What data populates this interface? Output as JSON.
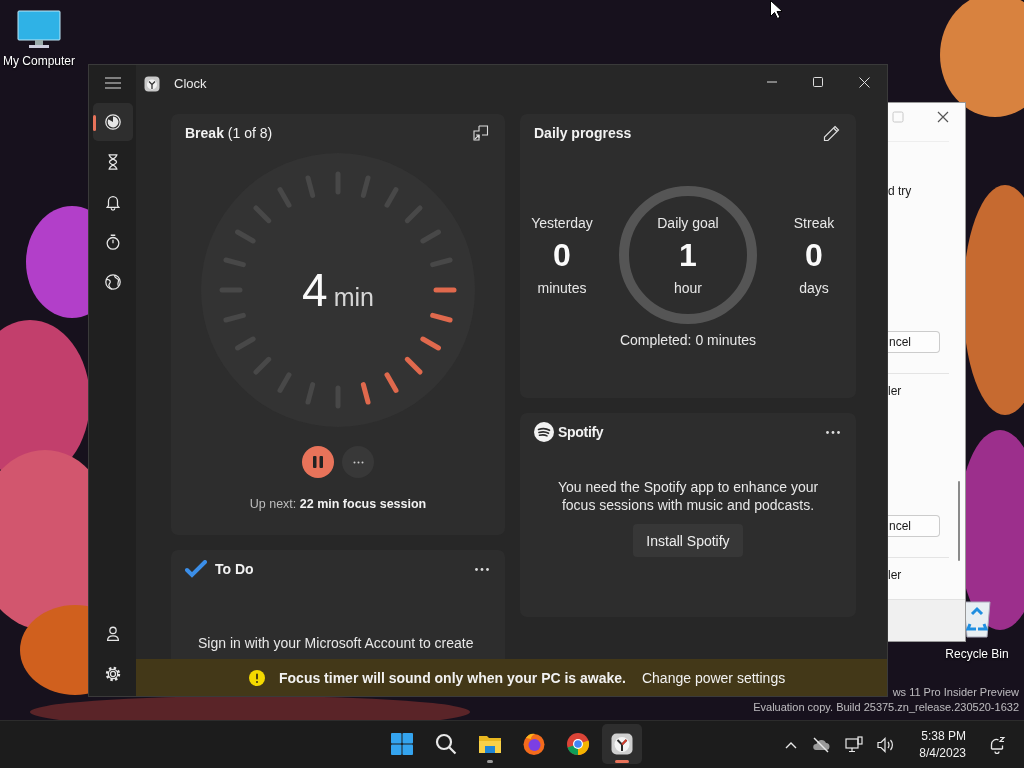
{
  "desktop_icons": [
    {
      "kind": "computer",
      "label": "My Computer"
    },
    {
      "kind": "recycle",
      "label": "Recycle Bin"
    }
  ],
  "watermark": [
    "ws 11 Pro Insider Preview",
    "Evaluation copy. Build 25375.zn_release.230520-1632"
  ],
  "background_window": {
    "sections": [
      {
        "text": "d try",
        "button": "ncel"
      },
      {
        "text": "ler",
        "button": "ncel"
      },
      {
        "text": "ler"
      }
    ]
  },
  "window": {
    "title": "Clock"
  },
  "sidebar": {
    "top": [
      {
        "kind": "focus",
        "selected": true
      },
      {
        "kind": "timer",
        "selected": false
      },
      {
        "kind": "alarm",
        "selected": false
      },
      {
        "kind": "stopwatch",
        "selected": false
      },
      {
        "kind": "world",
        "selected": false
      }
    ],
    "bottom": [
      {
        "kind": "account",
        "selected": false
      },
      {
        "kind": "settings",
        "selected": false
      }
    ]
  },
  "timer": {
    "title": "**Break** (1 of 8)",
    "value": "4",
    "unit": "min",
    "running": true,
    "up_next": "Up next: **22 min focus session**"
  },
  "todo": {
    "title": "To Do",
    "message": "Sign in with your Microsoft Account to create"
  },
  "daily": {
    "title": "Daily progress",
    "stats": [
      {
        "kind": "stat",
        "label": "Yesterday",
        "value": "0",
        "unit": "minutes"
      },
      {
        "kind": "goal",
        "label": "Daily goal",
        "value": "1",
        "unit": "hour"
      },
      {
        "kind": "stat",
        "label": "Streak",
        "value": "0",
        "unit": "days"
      }
    ],
    "completed": "Completed: 0 minutes"
  },
  "spotify": {
    "brand": "Spotify",
    "message": "You need the Spotify app to enhance your focus sessions with music and podcasts.",
    "button": "Install Spotify"
  },
  "banner": {
    "message": "Focus timer will sound only when your PC is awake.",
    "link": "Change power settings"
  },
  "taskbar": {
    "apps": [
      {
        "kind": "start",
        "running": false,
        "selected": false
      },
      {
        "kind": "search",
        "running": false,
        "selected": false
      },
      {
        "kind": "files",
        "running": true,
        "selected": false
      },
      {
        "kind": "firefox",
        "running": false,
        "selected": false
      },
      {
        "kind": "chrome",
        "running": false,
        "selected": false
      },
      {
        "kind": "clock",
        "running": true,
        "selected": true
      }
    ],
    "time": "5:38 PM",
    "date": "8/4/2023"
  }
}
